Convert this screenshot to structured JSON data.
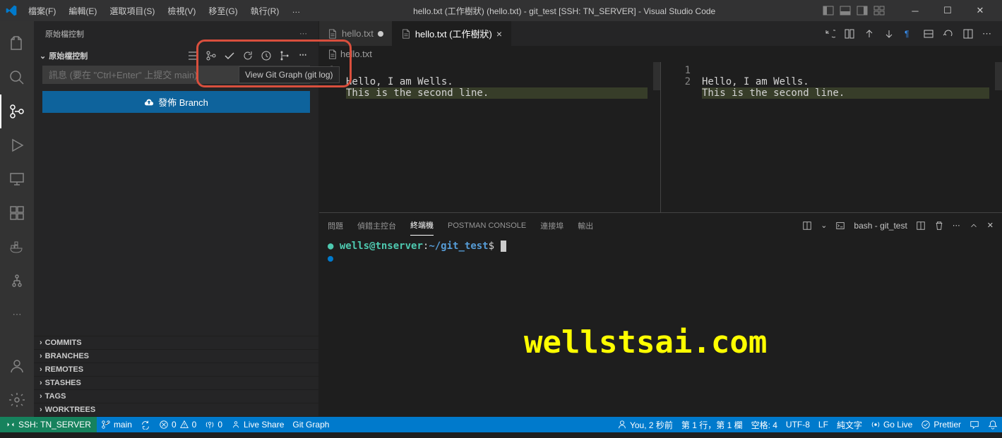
{
  "titlebar": {
    "menu": [
      "檔案(F)",
      "編輯(E)",
      "選取項目(S)",
      "檢視(V)",
      "移至(G)",
      "執行(R)",
      "…"
    ],
    "title": "hello.txt (工作樹狀) (hello.txt) - git_test [SSH: TN_SERVER] - Visual Studio Code"
  },
  "sidebar": {
    "header": "原始檔控制",
    "scm_header": "原始檔控制",
    "commit_placeholder": "訊息 (要在 \"Ctrl+Enter\" 上提交 main)",
    "publish_label": "發佈 Branch",
    "tooltip": "View Git Graph (git log)",
    "sections": [
      "COMMITS",
      "BRANCHES",
      "REMOTES",
      "STASHES",
      "TAGS",
      "WORKTREES"
    ]
  },
  "tabs": {
    "tab1": "hello.txt",
    "tab2": "hello.txt (工作樹狀)"
  },
  "breadcrumb": "hello.txt",
  "editor": {
    "left": {
      "lines": [
        "1"
      ],
      "content": [
        "Hello, I am Wells."
      ]
    },
    "right": {
      "lines": [
        "1",
        "2"
      ],
      "content": [
        "Hello, I am Wells.",
        "This is the second line."
      ]
    },
    "diff_added_display": "This is the second line."
  },
  "panel": {
    "tabs": [
      "問題",
      "偵錯主控台",
      "終端機",
      "POSTMAN CONSOLE",
      "連接埠",
      "輸出"
    ],
    "active_tab_index": 2,
    "terminal_label": "bash - git_test",
    "prompt": {
      "user": "wells@tnserver",
      "sep": ":",
      "path": "~/git_test",
      "symbol": "$"
    },
    "watermark": "wellstsai.com"
  },
  "statusbar": {
    "remote": "SSH: TN_SERVER",
    "branch": "main",
    "sync": "",
    "errors": "0",
    "warnings": "0",
    "ports": "0",
    "liveshare": "Live Share",
    "gitgraph": "Git Graph",
    "copilot": "You, 2 秒前",
    "position": "第 1 行，第 1 欄",
    "spaces": "空格: 4",
    "encoding": "UTF-8",
    "eol": "LF",
    "lang": "純文字",
    "golive": "Go Live",
    "prettier": "Prettier"
  }
}
